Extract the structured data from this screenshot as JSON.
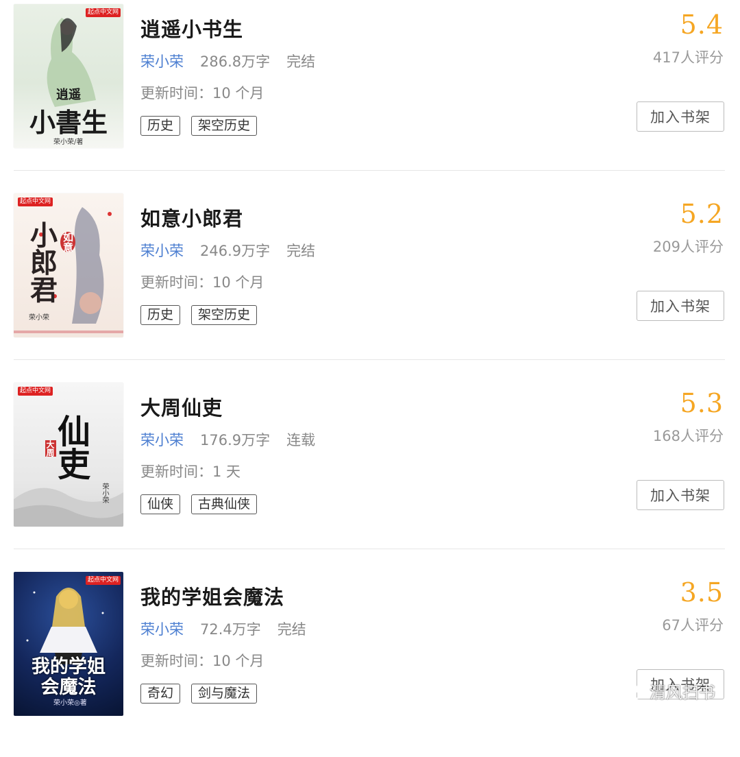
{
  "books": [
    {
      "title": "逍遥小书生",
      "author": "荣小荣",
      "words": "286.8万字",
      "status": "完结",
      "updated": "更新时间：10 个月",
      "tags": [
        "历史",
        "架空历史"
      ],
      "score": "5.4",
      "raters": "417人评分",
      "shelf_label": "加入书架",
      "cover": {
        "badge": "起点中文网",
        "lines": [
          "逍遥",
          "小書生"
        ],
        "author": "荣小荣/著",
        "bg": "#eef2ec",
        "ink": "#1a1a1a"
      }
    },
    {
      "title": "如意小郎君",
      "author": "荣小荣",
      "words": "246.9万字",
      "status": "完结",
      "updated": "更新时间：10 个月",
      "tags": [
        "历史",
        "架空历史"
      ],
      "score": "5.2",
      "raters": "209人评分",
      "shelf_label": "加入书架",
      "cover": {
        "badge": "起点中文网",
        "lines": [
          "如意",
          "小郎君"
        ],
        "author": "荣小荣",
        "bg": "#f7efe9",
        "ink": "#2a2222"
      }
    },
    {
      "title": "大周仙吏",
      "author": "荣小荣",
      "words": "176.9万字",
      "status": "连载",
      "updated": "更新时间：1 天",
      "tags": [
        "仙侠",
        "古典仙侠"
      ],
      "score": "5.3",
      "raters": "168人评分",
      "shelf_label": "加入书架",
      "cover": {
        "badge": "起点中文网",
        "lines": [
          "大周",
          "仙吏"
        ],
        "author": "荣小荣",
        "bg": "#f4f4f4",
        "ink": "#111111"
      }
    },
    {
      "title": "我的学姐会魔法",
      "author": "荣小荣",
      "words": "72.4万字",
      "status": "完结",
      "updated": "更新时间：10 个月",
      "tags": [
        "奇幻",
        "剑与魔法"
      ],
      "score": "3.5",
      "raters": "67人评分",
      "shelf_label": "加入书架",
      "cover": {
        "badge": "起点中文网",
        "lines": [
          "我的学姐",
          "会魔法"
        ],
        "author": "荣小荣◎著",
        "bg": "#0d1f4a",
        "ink": "#ffffff"
      }
    }
  ],
  "watermark": {
    "text": "清风扫书",
    "icon": "wechat-icon"
  },
  "colors": {
    "author": "#4d7fd1",
    "score": "#f5a623",
    "muted": "#888888"
  }
}
